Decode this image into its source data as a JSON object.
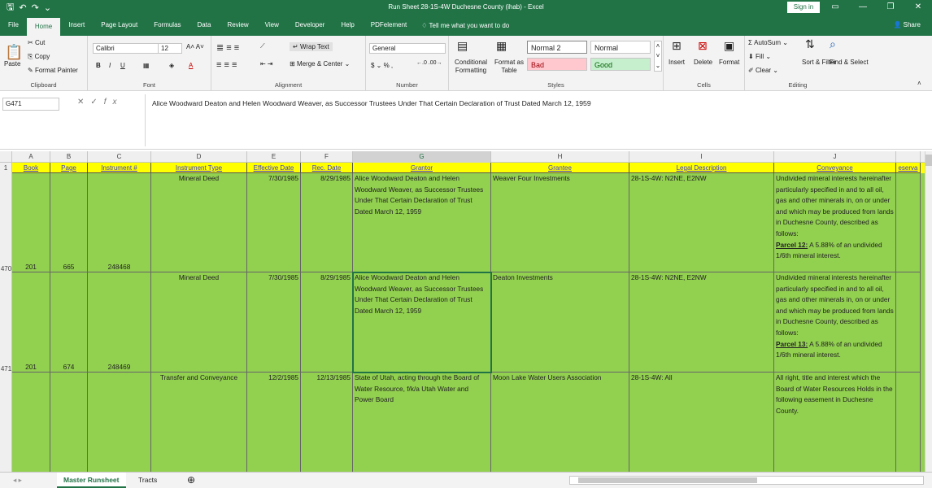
{
  "window": {
    "title": "Run Sheet 28-1S-4W Duchesne County (ihab)  -  Excel",
    "signin": "Sign in"
  },
  "menu": {
    "tabs": [
      "File",
      "Home",
      "Insert",
      "Page Layout",
      "Formulas",
      "Data",
      "Review",
      "View",
      "Developer",
      "Help",
      "PDFelement"
    ],
    "tellme": "Tell me what you want to do",
    "share": "Share"
  },
  "ribbon": {
    "clipboard": {
      "label": "Clipboard",
      "paste": "Paste",
      "cut": "Cut",
      "copy": "Copy",
      "format_painter": "Format Painter"
    },
    "font": {
      "label": "Font",
      "name": "Calibri",
      "size": "12"
    },
    "alignment": {
      "label": "Alignment",
      "wrap": "Wrap Text",
      "merge": "Merge & Center"
    },
    "number": {
      "label": "Number",
      "format": "General"
    },
    "styles": {
      "label": "Styles",
      "conditional": "Conditional Formatting",
      "format_as_table": "Format as Table",
      "normal2": "Normal 2",
      "normal": "Normal",
      "bad": "Bad",
      "good": "Good"
    },
    "cells": {
      "label": "Cells",
      "insert": "Insert",
      "delete": "Delete",
      "format": "Format"
    },
    "editing": {
      "label": "Editing",
      "autosum": "AutoSum",
      "fill": "Fill",
      "clear": "Clear",
      "sort": "Sort & Filter",
      "find": "Find & Select"
    }
  },
  "formula_bar": {
    "name_box": "G471",
    "formula": "Alice Woodward Deaton and Helen Woodward Weaver, as Successor Trustees Under That Certain Declaration of Trust Dated March 12, 1959"
  },
  "columns": [
    "A",
    "B",
    "C",
    "D",
    "E",
    "F",
    "G",
    "H",
    "I",
    "J",
    ""
  ],
  "headers": [
    "Book",
    "Page",
    "Instrument #",
    "Instrument Type",
    "Effective Date",
    "Rec. Date",
    "Grantor",
    "Grantee",
    "Legal Description",
    "Conveyance",
    "eserva"
  ],
  "row_numbers": [
    "1",
    "470",
    "471"
  ],
  "rows": [
    {
      "book": "201",
      "page": "665",
      "instrument": "248468",
      "type": "Mineral Deed",
      "effective": "7/30/1985",
      "rec": "8/29/1985",
      "grantor": "Alice Woodward Deaton and Helen Woodward Weaver, as Successor Trustees Under That Certain Declaration of Trust Dated March 12, 1959",
      "grantee": "Weaver Four Investments",
      "legal": "28-1S-4W: N2NE, E2NW",
      "conveyance": "Undivided mineral interests hereinafter particularly specified in and to all oil, gas and other minerals in, on or under and which may be produced from lands in Duchesne County, described as follows:",
      "parcel_label": "Parcel 12:",
      "parcel_text": " A 5.88% of an undivided 1/6th mineral interest."
    },
    {
      "book": "201",
      "page": "674",
      "instrument": "248469",
      "type": "Mineral Deed",
      "effective": "7/30/1985",
      "rec": "8/29/1985",
      "grantor": "Alice Woodward Deaton and Helen Woodward Weaver, as Successor Trustees Under That Certain Declaration of Trust Dated March 12, 1959",
      "grantee": "Deaton Investments",
      "legal": "28-1S-4W: N2NE, E2NW",
      "conveyance": "Undivided mineral interests hereinafter particularly specified in and to all oil, gas and other minerals in, on or under and which may be produced from lands in Duchesne County, described as follows:",
      "parcel_label": "Parcel 13:",
      "parcel_text": " A 5.88% of an undivided 1/6th mineral interest."
    },
    {
      "book": "",
      "page": "",
      "instrument": "",
      "type": "Transfer and Conveyance",
      "effective": "12/2/1985",
      "rec": "12/13/1985",
      "grantor": "State of Utah, acting through the Board of Water Resource, f/k/a Utah Water and Power Board",
      "grantee": "Moon Lake Water Users Association",
      "legal": "28-1S-4W: All",
      "conveyance": "All right, title and interest which the Board of Water Resources Holds in the following easement in Duchesne County.",
      "parcel_label": "",
      "parcel_text": ""
    }
  ],
  "sheets": [
    "Master Runsheet",
    "Tracts"
  ]
}
